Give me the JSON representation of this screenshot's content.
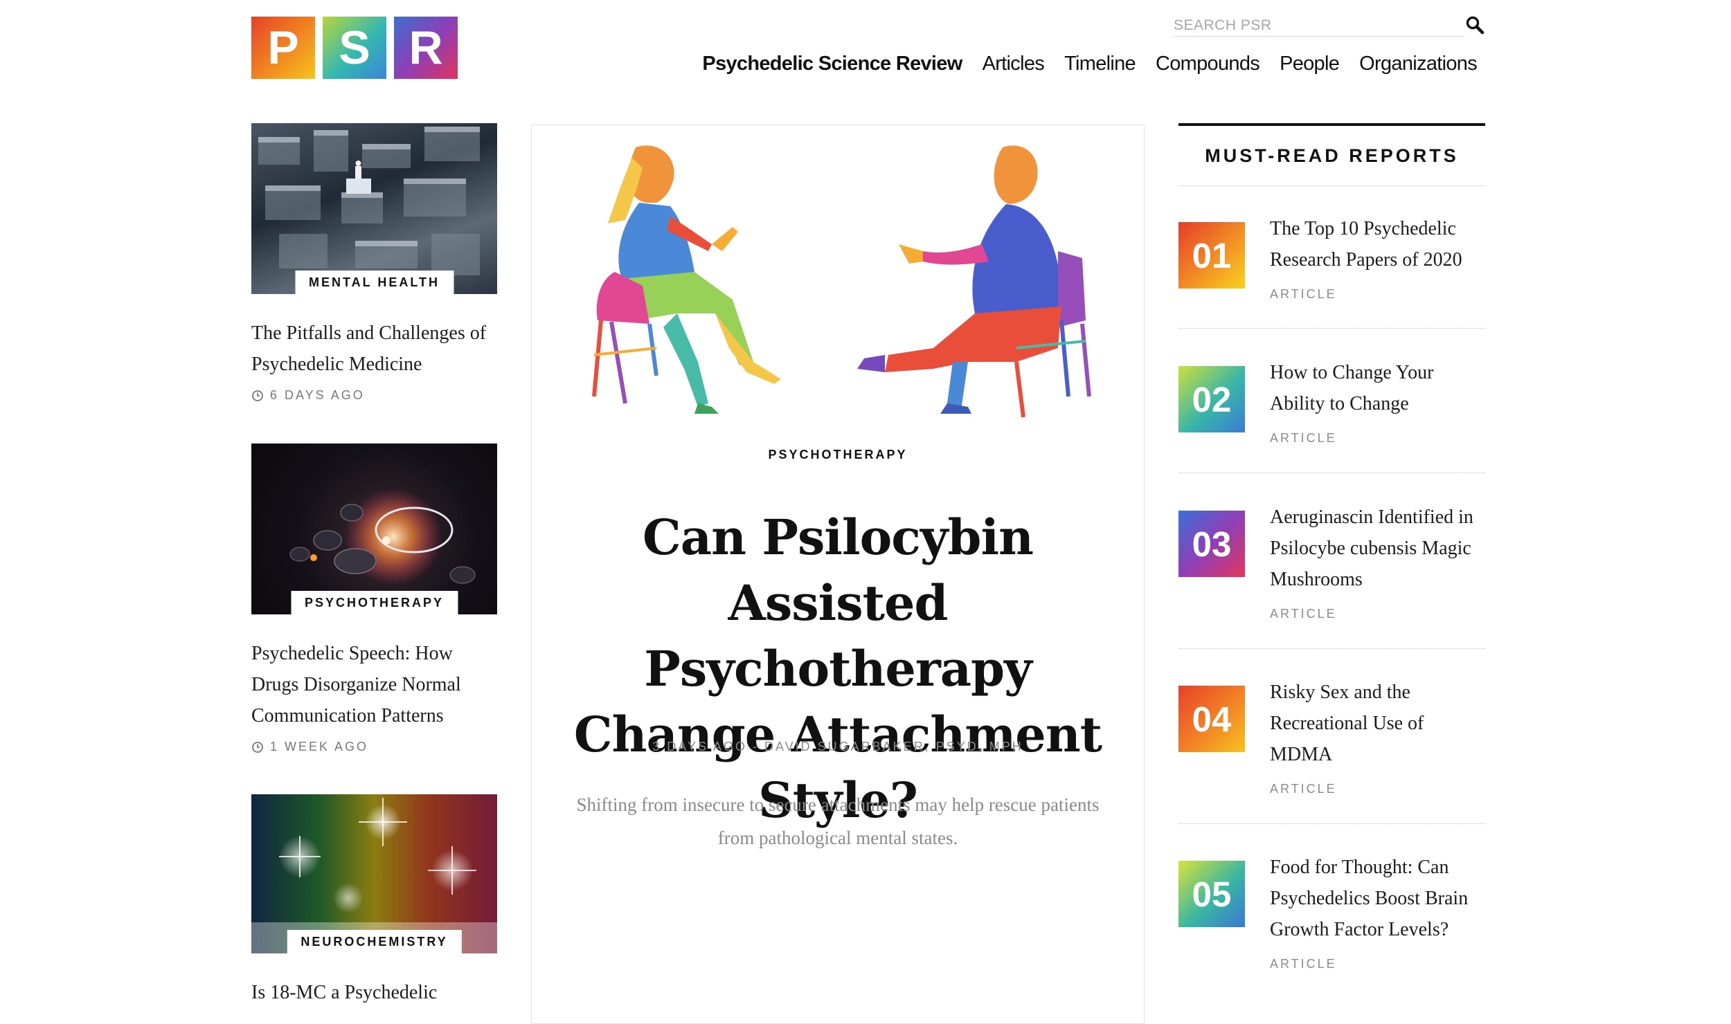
{
  "header": {
    "logo_letters": [
      "P",
      "S",
      "R"
    ],
    "search_placeholder": "SEARCH PSR",
    "nav": [
      "Psychedelic Science Review",
      "Articles",
      "Timeline",
      "Compounds",
      "People",
      "Organizations"
    ]
  },
  "left_column": [
    {
      "category": "MENTAL HEALTH",
      "title": "The Pitfalls and Challenges of Psychedelic Medicine",
      "time": "6 DAYS AGO"
    },
    {
      "category": "PSYCHOTHERAPY",
      "title": "Psychedelic Speech: How Drugs Disorganize Normal Communication Patterns",
      "time": "1 WEEK AGO"
    },
    {
      "category": "NEUROCHEMISTRY",
      "title": "Is 18-MC a Psychedelic"
    }
  ],
  "feature": {
    "category": "PSYCHOTHERAPY",
    "title": "Can Psilocybin Assisted Psychotherapy Change Attachment Style?",
    "meta": "3 DAYS AGO - DAVID SUGARBAKER, PSYD, MPH",
    "dek": "Shifting from insecure to secure attachments may help rescue patients from pathological mental states."
  },
  "must_read": {
    "heading": "MUST-READ REPORTS",
    "items": [
      {
        "num": "01",
        "title": "The Top 10 Psychedelic Research Papers of 2020",
        "type": "ARTICLE"
      },
      {
        "num": "02",
        "title": "How to Change Your Ability to Change",
        "type": "ARTICLE"
      },
      {
        "num": "03",
        "title": "Aeruginascin Identified in Psilocybe cubensis Magic Mushrooms",
        "type": "ARTICLE"
      },
      {
        "num": "04",
        "title": "Risky Sex and the Recreational Use of MDMA",
        "type": "ARTICLE"
      },
      {
        "num": "05",
        "title": "Food for Thought: Can Psychedelics Boost Brain Growth Factor Levels?",
        "type": "ARTICLE"
      }
    ]
  },
  "icons": [
    "search-icon",
    "clock-icon"
  ]
}
